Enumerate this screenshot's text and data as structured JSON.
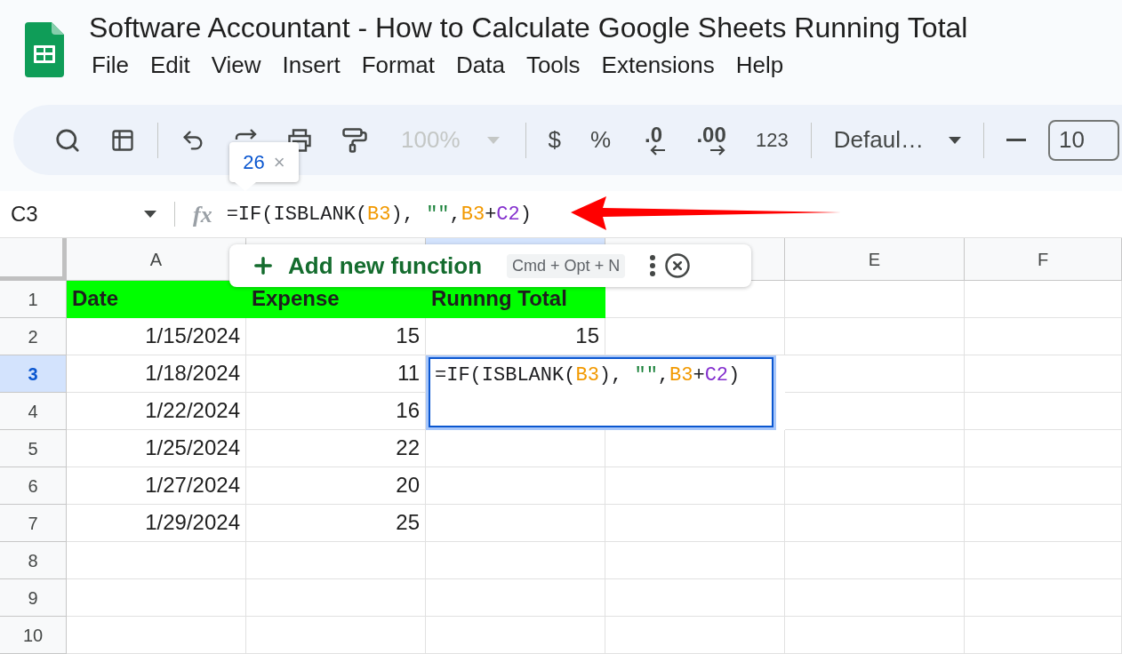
{
  "app": {
    "title": "Software Accountant - How to Calculate Google Sheets Running Total"
  },
  "menu": [
    "File",
    "Edit",
    "View",
    "Insert",
    "Format",
    "Data",
    "Tools",
    "Extensions",
    "Help"
  ],
  "toolbar": {
    "zoom": {
      "value": "100%",
      "disabled": true
    },
    "currency": "$",
    "percent": "%",
    "decrease_decimals": ".0",
    "increase_decimals": ".00",
    "number_format": "123",
    "font": "Defaul…",
    "font_size": "10"
  },
  "tooltip": {
    "value": "26",
    "close": "×"
  },
  "formula_bar": {
    "cell_ref": "C3",
    "function_label": "fx",
    "formula": [
      {
        "text": "=IF(ISBLANK(",
        "color": "#202124"
      },
      {
        "text": "B3",
        "color": "#f29900"
      },
      {
        "text": "), ",
        "color": "#202124"
      },
      {
        "text": "\"\"",
        "color": "#188038"
      },
      {
        "text": ",",
        "color": "#202124"
      },
      {
        "text": "B3",
        "color": "#f29900"
      },
      {
        "text": "+",
        "color": "#202124"
      },
      {
        "text": "C2",
        "color": "#8430ce"
      },
      {
        "text": ")",
        "color": "#202124"
      }
    ]
  },
  "suggestion": {
    "label": "Add new function",
    "shortcut": "Cmd + Opt + N"
  },
  "sheet": {
    "columns": [
      {
        "label": "A",
        "selected": false
      },
      {
        "selected": false
      },
      {
        "selected": true
      },
      {
        "selected": false
      },
      {
        "label": "E",
        "selected": false
      },
      {
        "label": "F",
        "selected": false
      }
    ],
    "rows": [
      {
        "number": "1",
        "selected": false,
        "cells": [
          {
            "text": "Date",
            "kind": "heading"
          },
          {
            "text": "Expense",
            "kind": "heading"
          },
          {
            "text": "Runnng Total",
            "kind": "heading"
          }
        ]
      },
      {
        "number": "2",
        "selected": false,
        "cells": [
          {
            "text": "1/15/2024",
            "kind": "value"
          },
          {
            "text": "15",
            "kind": "value"
          },
          {
            "text": "15",
            "kind": "value"
          }
        ]
      },
      {
        "number": "3",
        "selected": true,
        "cells": [
          {
            "text": "1/18/2024",
            "kind": "value"
          },
          {
            "text": "11",
            "kind": "value"
          }
        ]
      },
      {
        "number": "4",
        "selected": false,
        "cells": [
          {
            "text": "1/22/2024",
            "kind": "value"
          },
          {
            "text": "16",
            "kind": "value"
          }
        ]
      },
      {
        "number": "5",
        "selected": false,
        "cells": [
          {
            "text": "1/25/2024",
            "kind": "value"
          },
          {
            "text": "22",
            "kind": "value"
          }
        ]
      },
      {
        "number": "6",
        "selected": false,
        "cells": [
          {
            "text": "1/27/2024",
            "kind": "value"
          },
          {
            "text": "20",
            "kind": "value"
          }
        ]
      },
      {
        "number": "7",
        "selected": false,
        "cells": [
          {
            "text": "1/29/2024",
            "kind": "value"
          },
          {
            "text": "25",
            "kind": "value"
          }
        ]
      },
      {
        "number": "8",
        "selected": false,
        "cells": []
      },
      {
        "number": "9",
        "selected": false,
        "cells": []
      },
      {
        "number": "10",
        "selected": false,
        "cells": []
      }
    ],
    "editor": {
      "formula": [
        {
          "text": "=IF(ISBLANK(",
          "color": "#202124"
        },
        {
          "text": "B3",
          "color": "#f29900"
        },
        {
          "text": "), ",
          "color": "#202124"
        },
        {
          "text": "\"\"",
          "color": "#188038"
        },
        {
          "text": ",",
          "color": "#202124"
        },
        {
          "text": "B3",
          "color": "#f29900"
        },
        {
          "text": "+",
          "color": "#202124"
        },
        {
          "text": "C2",
          "color": "#8430ce"
        },
        {
          "text": ")",
          "color": "#202124"
        }
      ]
    }
  }
}
